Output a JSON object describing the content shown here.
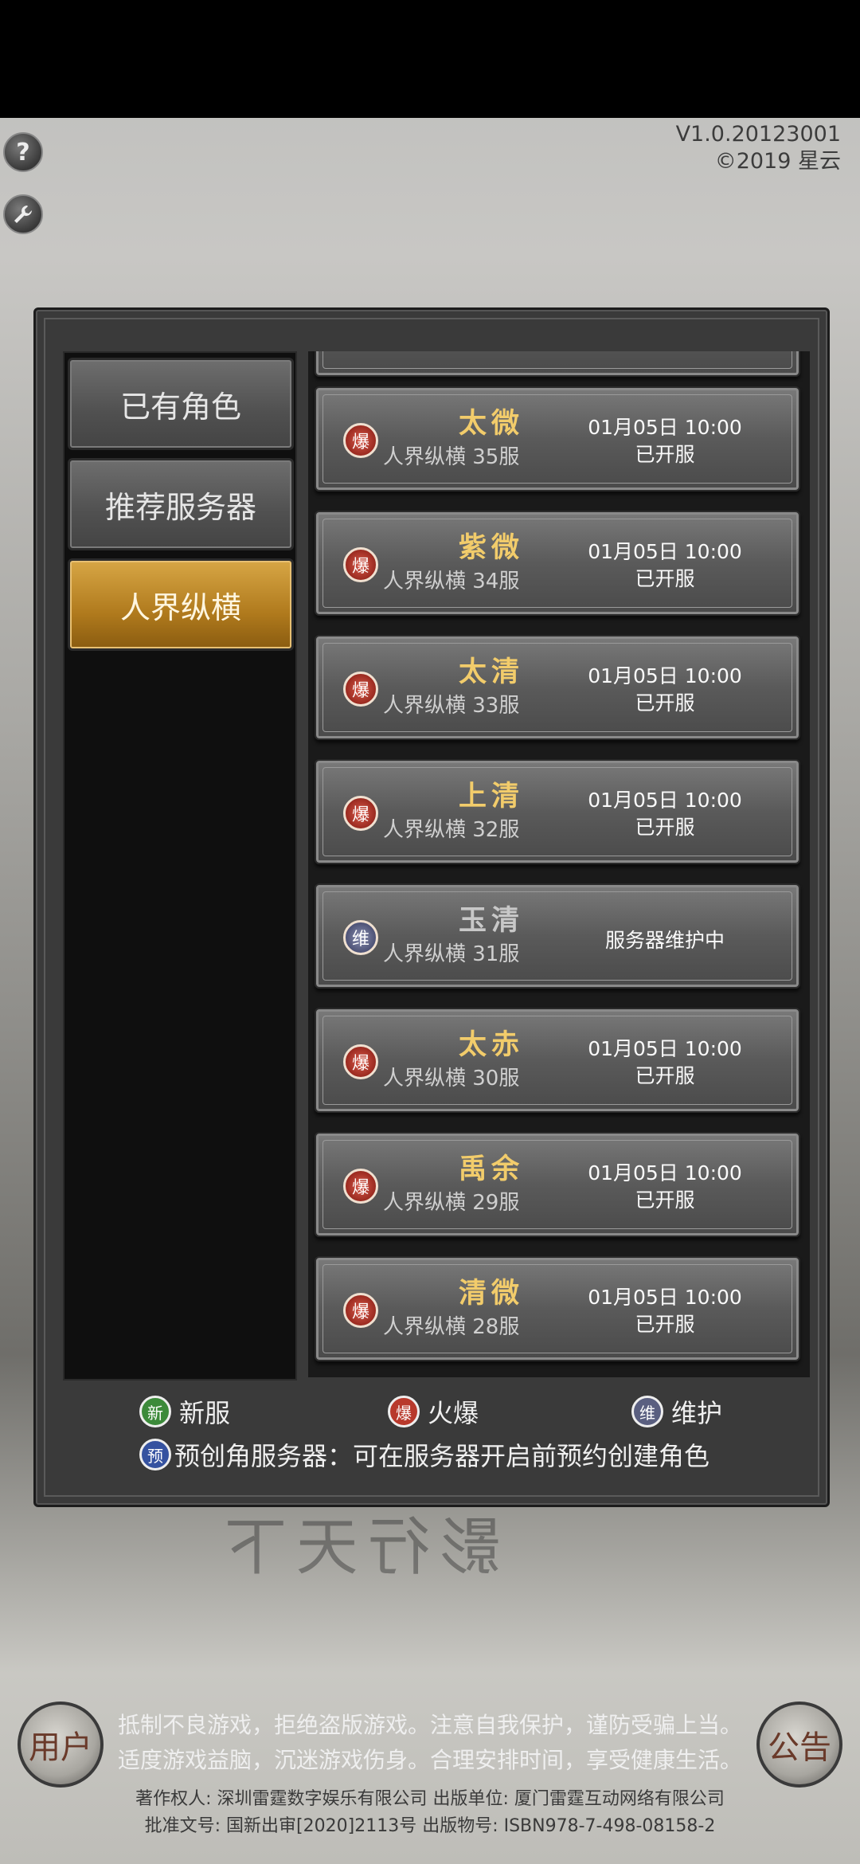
{
  "version": {
    "line1": "V1.0.20123001",
    "line2": "©2019 星云"
  },
  "top_buttons": {
    "help_icon_text": "?",
    "help_icon": "question-icon",
    "settings_icon": "wrench-icon"
  },
  "tabs": [
    {
      "label": "已有角色",
      "active": false
    },
    {
      "label": "推荐服务器",
      "active": false
    },
    {
      "label": "人界纵横",
      "active": true
    }
  ],
  "servers": [
    {
      "name": "太微",
      "sub": "人界纵横 35服",
      "badge": "爆",
      "date": "01月05日 10:00",
      "state": "已开服"
    },
    {
      "name": "紫微",
      "sub": "人界纵横 34服",
      "badge": "爆",
      "date": "01月05日 10:00",
      "state": "已开服"
    },
    {
      "name": "太清",
      "sub": "人界纵横 33服",
      "badge": "爆",
      "date": "01月05日 10:00",
      "state": "已开服"
    },
    {
      "name": "上清",
      "sub": "人界纵横 32服",
      "badge": "爆",
      "date": "01月05日 10:00",
      "state": "已开服"
    },
    {
      "name": "玉清",
      "sub": "人界纵横 31服",
      "badge": "维",
      "maintenance": "服务器维护中"
    },
    {
      "name": "太赤",
      "sub": "人界纵横 30服",
      "badge": "爆",
      "date": "01月05日 10:00",
      "state": "已开服"
    },
    {
      "name": "禹余",
      "sub": "人界纵横 29服",
      "badge": "爆",
      "date": "01月05日 10:00",
      "state": "已开服"
    },
    {
      "name": "清微",
      "sub": "人界纵横 28服",
      "badge": "爆",
      "date": "01月05日 10:00",
      "state": "已开服"
    }
  ],
  "legend": {
    "new_badge": "新",
    "new_label": "新服",
    "hot_badge": "爆",
    "hot_label": "火爆",
    "maint_badge": "维",
    "maint_label": "维护",
    "pre_badge": "预",
    "pre_label": "预创角服务器：可在服务器开启前预约创建角色"
  },
  "colors": {
    "new": "#3c8a3a",
    "hot": "#b8392c",
    "maint": "#5a5f80",
    "pre": "#3552a0",
    "active_tab": "#c38e2e"
  },
  "bottom": {
    "line1": "抵制不良游戏，拒绝盗版游戏。注意自我保护，谨防受骗上当。",
    "line2": "适度游戏益脑，沉迷游戏伤身。合理安排时间，享受健康生活。",
    "line3": "著作权人: 深圳雷霆数字娱乐有限公司 出版单位: 厦门雷霆互动网络有限公司",
    "line4": "批准文号: 国新出审[2020]2113号 出版物号: ISBN978-7-498-08158-2",
    "user_corner": "用户",
    "notice_corner": "公告"
  }
}
